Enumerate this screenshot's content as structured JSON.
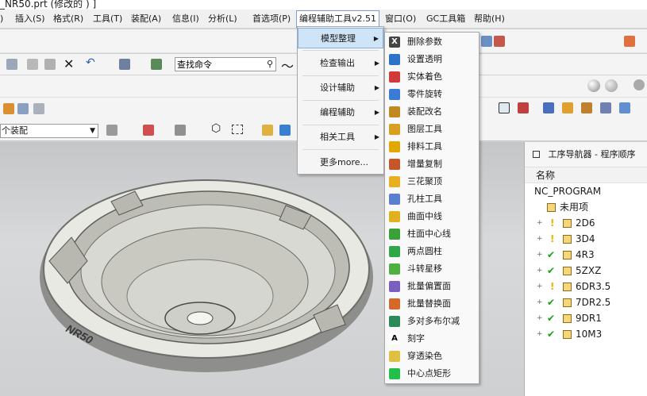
{
  "window": {
    "title": "_NR50.prt  (修改的 ) ]"
  },
  "menubar": {
    "items": [
      {
        "label": ")"
      },
      {
        "label": "插入(S)"
      },
      {
        "label": "格式(R)"
      },
      {
        "label": "工具(T)"
      },
      {
        "label": "装配(A)"
      },
      {
        "label": "信息(I)"
      },
      {
        "label": "分析(L)"
      },
      {
        "label": "首选项(P)"
      },
      {
        "label": "编程辅助工具v2.51"
      },
      {
        "label": "窗口(O)"
      },
      {
        "label": "GC工具箱"
      },
      {
        "label": "帮助(H)"
      }
    ]
  },
  "toolbar": {
    "search": {
      "value": "查找命令",
      "icon": "magnifier-icon"
    },
    "assembly_selector": {
      "value": "个装配"
    }
  },
  "dropdown": {
    "items": [
      {
        "label": "模型整理",
        "has_submenu": true,
        "active": true
      },
      {
        "label": "检查输出",
        "has_submenu": true
      },
      {
        "label": "设计辅助",
        "has_submenu": true
      },
      {
        "label": "编程辅助",
        "has_submenu": true
      },
      {
        "label": "相关工具",
        "has_submenu": true
      },
      {
        "label": "更多more...",
        "has_submenu": false
      }
    ]
  },
  "submenu": {
    "items": [
      {
        "label": "删除参数",
        "icon": "delete-params-icon",
        "color": "#444444",
        "glyph": "X"
      },
      {
        "label": "设置透明",
        "icon": "cube-transparent-icon",
        "color": "#2b74c9",
        "glyph": ""
      },
      {
        "label": "实体着色",
        "icon": "color-bars-icon",
        "color": "#d23a3a",
        "glyph": ""
      },
      {
        "label": "零件旋转",
        "icon": "rotate-part-icon",
        "color": "#3a7bd5",
        "glyph": ""
      },
      {
        "label": "装配改名",
        "icon": "tree-rename-icon",
        "color": "#c08a20",
        "glyph": ""
      },
      {
        "label": "图层工具",
        "icon": "layers-icon",
        "color": "#d8a020",
        "glyph": ""
      },
      {
        "label": "排料工具",
        "icon": "layout-dots-icon",
        "color": "#e0a800",
        "glyph": ""
      },
      {
        "label": "增量复制",
        "icon": "copy-icon",
        "color": "#c4572a",
        "glyph": ""
      },
      {
        "label": "三花聚顶",
        "icon": "flower-icon",
        "color": "#e8b020",
        "glyph": ""
      },
      {
        "label": "孔柱工具",
        "icon": "cylinder-icon",
        "color": "#5b7fd0",
        "glyph": ""
      },
      {
        "label": "曲面中线",
        "icon": "surface-midline-icon",
        "color": "#e0b020",
        "glyph": ""
      },
      {
        "label": "柱面中心线",
        "icon": "cylinder-centerline-icon",
        "color": "#3aa03a",
        "glyph": ""
      },
      {
        "label": "两点圆柱",
        "icon": "two-point-cylinder-icon",
        "color": "#2fa84a",
        "glyph": ""
      },
      {
        "label": "斗转星移",
        "icon": "move-stars-icon",
        "color": "#4fb040",
        "glyph": ""
      },
      {
        "label": "批量偏置面",
        "icon": "batch-offset-icon",
        "color": "#7a5fc0",
        "glyph": ""
      },
      {
        "label": "批量替换面",
        "icon": "batch-replace-icon",
        "color": "#d46a2a",
        "glyph": ""
      },
      {
        "label": "多对多布尔减",
        "icon": "boolean-subtract-icon",
        "color": "#2a8a5a",
        "glyph": ""
      },
      {
        "label": "刻字",
        "icon": "engrave-letter-icon",
        "color": "#ffffff",
        "glyph": "A"
      },
      {
        "label": "穿透染色",
        "icon": "penetrate-color-icon",
        "color": "#e0c040",
        "glyph": ""
      },
      {
        "label": "中心点矩形",
        "icon": "center-rectangle-icon",
        "color": "#22c04a",
        "glyph": ""
      }
    ]
  },
  "navigator": {
    "title": "工序导航器 - 程序顺序",
    "column": "名称",
    "root": "NC_PROGRAM",
    "rows": [
      {
        "label": "未用项",
        "status": "none"
      },
      {
        "label": "2D6",
        "status": "pending"
      },
      {
        "label": "3D4",
        "status": "pending"
      },
      {
        "label": "4R3",
        "status": "complete"
      },
      {
        "label": "5ZXZ",
        "status": "complete"
      },
      {
        "label": "6DR3.5",
        "status": "pending"
      },
      {
        "label": "7DR2.5",
        "status": "complete"
      },
      {
        "label": "9DR1",
        "status": "complete"
      },
      {
        "label": "10M3",
        "status": "complete"
      }
    ]
  },
  "viewport": {
    "engraving": "NR50"
  }
}
